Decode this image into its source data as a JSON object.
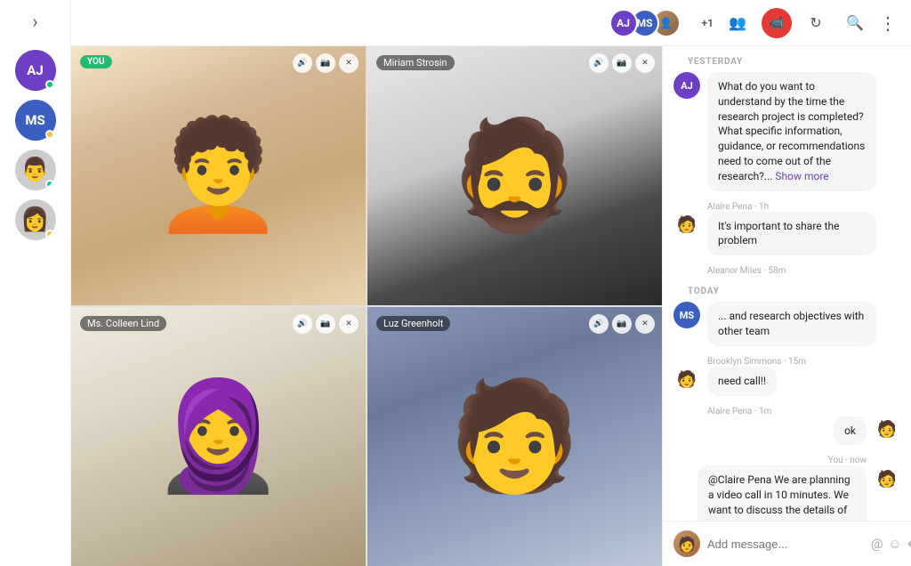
{
  "sidebar": {
    "chevron": "❯",
    "users": [
      {
        "id": "aj",
        "initials": "AJ",
        "type": "initials",
        "status": "online"
      },
      {
        "id": "ms",
        "initials": "MS",
        "type": "initials",
        "status": "away"
      },
      {
        "id": "p1",
        "type": "photo",
        "emoji": "👨",
        "status": "online"
      },
      {
        "id": "p2",
        "type": "photo",
        "emoji": "👩",
        "status": "away"
      }
    ]
  },
  "topbar": {
    "plus_label": "+1",
    "video_icon": "📹",
    "add_people_icon": "👥",
    "refresh_icon": "↻",
    "search_icon": "🔍",
    "more_icon": "⋮"
  },
  "video_grid": {
    "cells": [
      {
        "id": "v1",
        "label": "YOU",
        "label_type": "you",
        "name": ""
      },
      {
        "id": "v2",
        "label": "Miriam Strosin",
        "label_type": "name",
        "name": "Miriam Strosin"
      },
      {
        "id": "v3",
        "label": "Ms. Colleen Lind",
        "label_type": "name",
        "name": "Ms. Colleen Lind"
      },
      {
        "id": "v4",
        "label": "Luz Greenholt",
        "label_type": "name",
        "name": "Luz Greenholt"
      }
    ]
  },
  "chat": {
    "sections": [
      {
        "label": "YESTERDAY",
        "messages": [
          {
            "id": "m1",
            "avatar_type": "initials",
            "avatar_class": "aj",
            "initials": "AJ",
            "text": "What do you want to understand by the time the research project is completed? What specific information, guidance, or recommendations need to come out of the research?...",
            "show_more": "Show more",
            "sender": "Alaire Pena",
            "time": "1h",
            "side": "left"
          },
          {
            "id": "m2",
            "avatar_type": "photo",
            "avatar_class": "photo",
            "emoji": "🧑",
            "text": "It's important to share the problem",
            "sender": "Aleanor Miles",
            "time": "58m",
            "side": "left"
          }
        ]
      },
      {
        "label": "TODAY",
        "messages": [
          {
            "id": "m3",
            "avatar_type": "initials",
            "avatar_class": "ms",
            "initials": "MS",
            "text": "... and research objectives with other team",
            "sender": "Brooklyn Simmons",
            "time": "15m",
            "side": "left"
          },
          {
            "id": "m4",
            "avatar_type": "photo",
            "avatar_class": "photo",
            "emoji": "🧑",
            "text": "need call!!",
            "sender": "Alaire Pena",
            "time": "1m",
            "side": "left"
          },
          {
            "id": "m5",
            "avatar_type": "photo",
            "avatar_class": "photo",
            "emoji": "👤",
            "text": "ok",
            "sender": "You",
            "time": "now",
            "side": "right"
          },
          {
            "id": "m6",
            "avatar_type": "photo",
            "avatar_class": "photo",
            "emoji": "👤",
            "text": "@Claire Pena We are planning a video call in 10 minutes. We want to discuss the details of the work process.",
            "sender": "You",
            "time": "now",
            "side": "right"
          }
        ]
      }
    ],
    "input": {
      "placeholder": "Add message...",
      "at_icon": "@",
      "emoji_icon": "☺",
      "send_icon": "↵"
    }
  }
}
